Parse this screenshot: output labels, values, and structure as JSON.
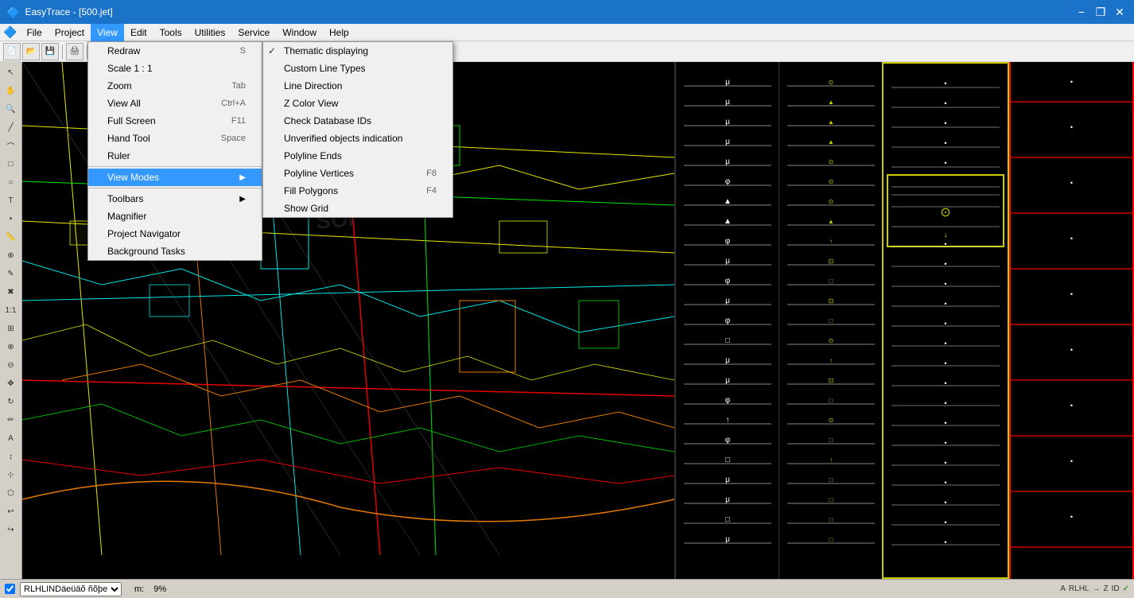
{
  "app": {
    "title": "EasyTrace - [500.jet]",
    "icon": "easytrace-icon"
  },
  "titlebar": {
    "minimize": "−",
    "restore": "❐",
    "close": "✕"
  },
  "menubar": {
    "items": [
      {
        "id": "file",
        "label": "File"
      },
      {
        "id": "project",
        "label": "Project"
      },
      {
        "id": "view",
        "label": "View",
        "active": true
      },
      {
        "id": "edit",
        "label": "Edit"
      },
      {
        "id": "tools",
        "label": "Tools"
      },
      {
        "id": "utilities",
        "label": "Utilities"
      },
      {
        "id": "service",
        "label": "Service"
      },
      {
        "id": "window",
        "label": "Window"
      },
      {
        "id": "help",
        "label": "Help"
      }
    ]
  },
  "view_menu": {
    "items": [
      {
        "label": "Redraw",
        "shortcut": "S",
        "check": false,
        "submenu": false
      },
      {
        "label": "Scale 1 : 1",
        "shortcut": "",
        "check": false,
        "submenu": false
      },
      {
        "label": "Zoom",
        "shortcut": "Tab",
        "check": false,
        "submenu": false
      },
      {
        "label": "View All",
        "shortcut": "Ctrl+A",
        "check": false,
        "submenu": false
      },
      {
        "label": "Full Screen",
        "shortcut": "F11",
        "check": false,
        "submenu": false
      },
      {
        "label": "Hand Tool",
        "shortcut": "Space",
        "check": false,
        "submenu": false
      },
      {
        "label": "Ruler",
        "shortcut": "",
        "check": false,
        "submenu": false
      },
      {
        "label": "View Modes",
        "shortcut": "",
        "check": false,
        "submenu": true,
        "highlighted": true
      },
      {
        "label": "Toolbars",
        "shortcut": "",
        "check": false,
        "submenu": true
      },
      {
        "label": "Magnifier",
        "shortcut": "",
        "check": false,
        "submenu": false
      },
      {
        "label": "Project Navigator",
        "shortcut": "",
        "check": false,
        "submenu": false
      },
      {
        "label": "Background Tasks",
        "shortcut": "",
        "check": false,
        "submenu": false
      }
    ]
  },
  "viewmodes_submenu": {
    "items": [
      {
        "label": "Thematic displaying",
        "shortcut": "",
        "check": true
      },
      {
        "label": "Custom Line Types",
        "shortcut": "",
        "check": false
      },
      {
        "label": "Line Direction",
        "shortcut": "",
        "check": false
      },
      {
        "label": "Z Color View",
        "shortcut": "",
        "check": false
      },
      {
        "label": "Check Database IDs",
        "shortcut": "",
        "check": false
      },
      {
        "label": "Unverified objects indication",
        "shortcut": "",
        "check": false
      },
      {
        "label": "Polyline Ends",
        "shortcut": "",
        "check": false
      },
      {
        "label": "Polyline Vertices",
        "shortcut": "F8",
        "check": false
      },
      {
        "label": "Fill Polygons",
        "shortcut": "F4",
        "check": false
      },
      {
        "label": "Show Grid",
        "shortcut": "",
        "check": false
      }
    ]
  },
  "statusbar": {
    "layer_select": "RLHLINDäeüäõ ñõþe",
    "zoom_percent": "9%",
    "m_label": "m:"
  }
}
